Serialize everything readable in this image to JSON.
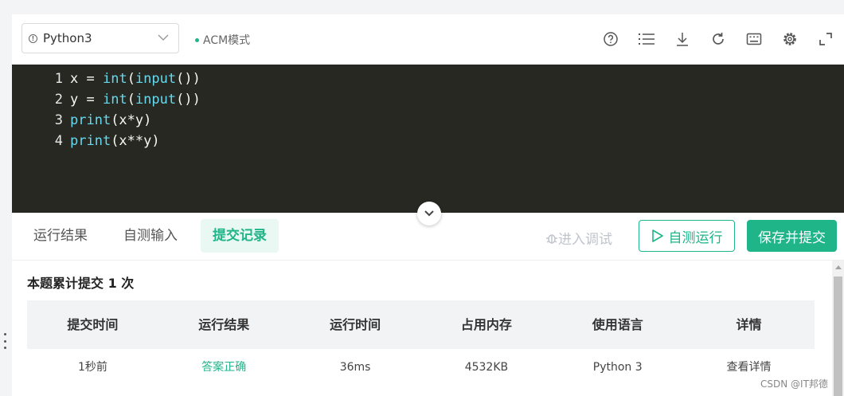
{
  "toolbar": {
    "language": "Python3",
    "mode": "ACM模式",
    "icons": [
      "help-icon",
      "list-icon",
      "download-icon",
      "refresh-icon",
      "keyboard-icon",
      "gear-icon",
      "fullscreen-icon"
    ]
  },
  "editor": {
    "lines": [
      {
        "num": "1",
        "tokens": [
          [
            "x",
            "id"
          ],
          [
            " = ",
            "op"
          ],
          [
            "int",
            "fn"
          ],
          [
            "(",
            "p"
          ],
          [
            "input",
            "fn"
          ],
          [
            "())",
            "p"
          ]
        ]
      },
      {
        "num": "2",
        "tokens": [
          [
            "y",
            "id"
          ],
          [
            " = ",
            "op"
          ],
          [
            "int",
            "fn"
          ],
          [
            "(",
            "p"
          ],
          [
            "input",
            "fn"
          ],
          [
            "())",
            "p"
          ]
        ]
      },
      {
        "num": "3",
        "tokens": [
          [
            "print",
            "fn"
          ],
          [
            "(x*y)",
            "p"
          ]
        ]
      },
      {
        "num": "4",
        "tokens": [
          [
            "print",
            "fn"
          ],
          [
            "(x**y)",
            "p"
          ]
        ]
      }
    ]
  },
  "panel": {
    "tabs": [
      "运行结果",
      "自测输入",
      "提交记录"
    ],
    "active_tab": "提交记录",
    "debug_label": "进入调试",
    "run_label": "自测运行",
    "submit_label": "保存并提交"
  },
  "records": {
    "summary": "本题累计提交 1 次",
    "headers": [
      "提交时间",
      "运行结果",
      "运行时间",
      "占用内存",
      "使用语言",
      "详情"
    ],
    "rows": [
      [
        "1秒前",
        "答案正确",
        "36ms",
        "4532KB",
        "Python 3",
        "查看详情"
      ]
    ]
  },
  "colors": {
    "accent": "#1fb589",
    "editor_bg": "#272822",
    "fn_color": "#66d9ef"
  },
  "watermark": "CSDN @IT邦德"
}
